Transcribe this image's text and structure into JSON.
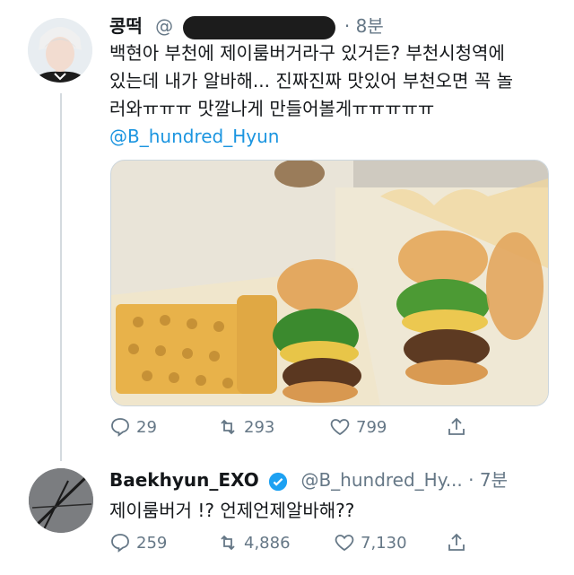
{
  "tweet1": {
    "author_name": "콩떡",
    "handle_prefix": "@",
    "separator": "·",
    "time": "8분",
    "text_lines": [
      "백현아 부천에 제이룸버거라구 있거든? 부천시청역에",
      "있는데 내가 알바해... 진짜진짜 맛있어 부천오면 꼭 놀",
      "러와ㅠㅠㅠ 맛깔나게 만들어볼게ㅠㅠㅠㅠㅠ"
    ],
    "mention": "@B_hundred_Hyun",
    "replies": "29",
    "retweets": "293",
    "likes": "799"
  },
  "tweet2": {
    "author_name": "Baekhyun_EXO",
    "handle": "@B_hundred_Hy...",
    "separator": "·",
    "time": "7분",
    "text": "제이룸버거 !? 언제언제알바해??",
    "replies": "259",
    "retweets": "4,886",
    "likes": "7,130"
  },
  "colors": {
    "accent": "#1b95e0",
    "muted": "#657786",
    "text": "#14171a",
    "verified": "#1da1f2"
  }
}
